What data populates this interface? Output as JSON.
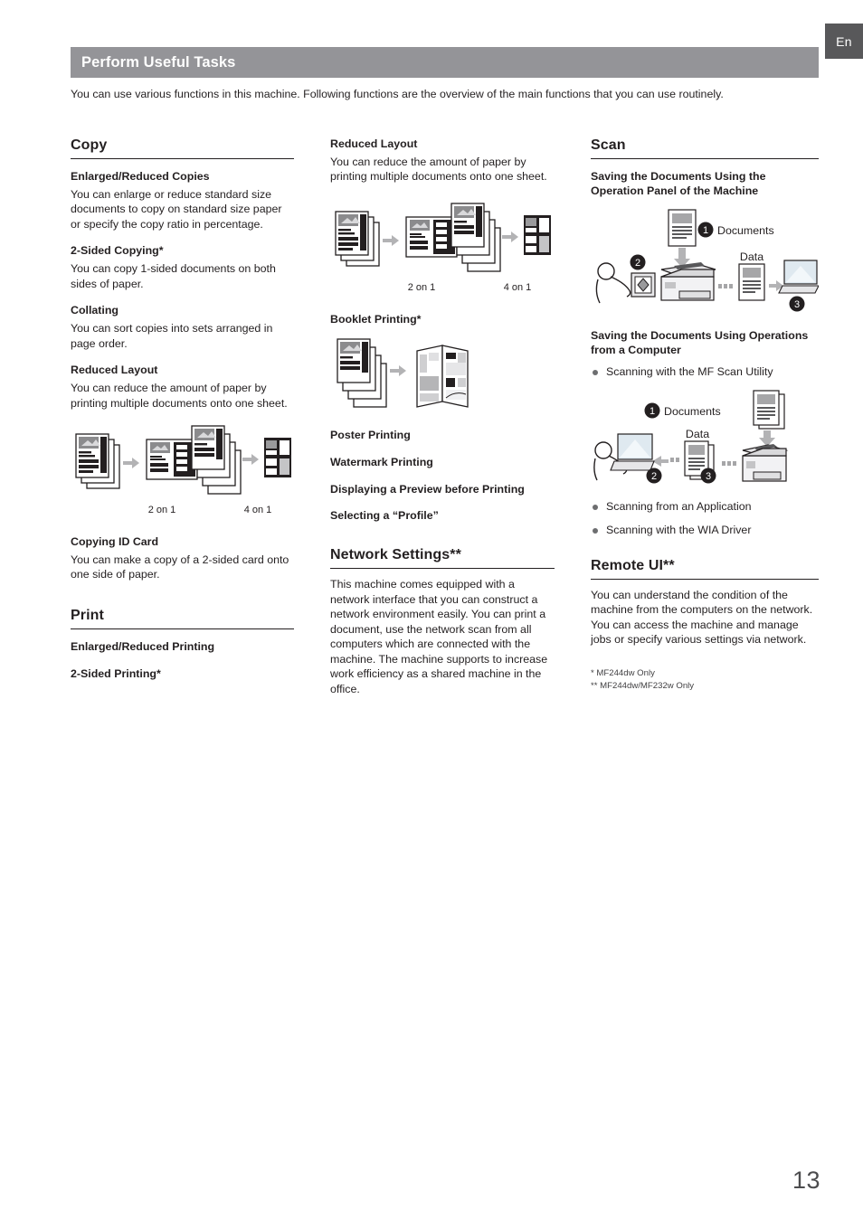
{
  "lang_tab": {
    "label": "En"
  },
  "header": {
    "title": "Perform Useful Tasks"
  },
  "intro": "You can use various functions in this machine. Following functions are the overview of the main functions that you can use routinely.",
  "columns": {
    "left": {
      "copy": {
        "title": "Copy",
        "items": [
          {
            "heading": "Enlarged/Reduced Copies",
            "body": "You can enlarge or reduce standard size documents to copy on standard size paper or specify the copy ratio in percentage."
          },
          {
            "heading": "2-Sided Copying*",
            "body": "You can copy 1-sided documents on both sides of paper."
          },
          {
            "heading": "Collating",
            "body": "You can sort copies into sets arranged in page order."
          },
          {
            "heading": "Reduced Layout",
            "body": "You can reduce the amount of paper by printing multiple documents onto one sheet."
          },
          {
            "heading": "Copying ID Card",
            "body": "You can make a copy of a 2-sided card onto one side of paper."
          }
        ],
        "figure_captions": {
          "left": "2 on 1",
          "right": "4 on 1"
        }
      },
      "print": {
        "title": "Print",
        "items": [
          {
            "heading": "Enlarged/Reduced Printing"
          },
          {
            "heading": "2-Sided Printing*"
          }
        ]
      }
    },
    "middle": {
      "reduced_layout": {
        "heading": "Reduced Layout",
        "body": "You can reduce the amount of paper by printing multiple documents onto one sheet.",
        "figure_captions": {
          "left": "2 on 1",
          "right": "4 on 1"
        }
      },
      "booklet": {
        "heading": "Booklet Printing*"
      },
      "extra_items": [
        {
          "heading": "Poster Printing"
        },
        {
          "heading": "Watermark Printing"
        },
        {
          "heading": "Displaying a Preview before Printing"
        },
        {
          "heading": "Selecting a “Profile”"
        }
      ],
      "network": {
        "title": "Network Settings**",
        "body": "This machine comes equipped with a network interface that you can construct a network environment easily. You can print a document, use the network scan from all computers which are connected with the machine. The machine supports to increase work efficiency as a shared machine in the office."
      }
    },
    "right": {
      "scan": {
        "title": "Scan",
        "panel_heading": "Saving the Documents Using the Operation Panel of the Machine",
        "panel_figure_labels": {
          "documents": "Documents",
          "data": "Data",
          "step1": "1",
          "step2": "2",
          "step3": "3"
        },
        "computer_heading": "Saving the Documents Using Operations from a Computer",
        "bullets_before": [
          "Scanning with the MF Scan Utility"
        ],
        "computer_figure_labels": {
          "documents": "Documents",
          "data": "Data",
          "step1": "1",
          "step2": "2",
          "step3": "3"
        },
        "bullets_after": [
          "Scanning from an Application",
          "Scanning with the WIA Driver"
        ]
      },
      "remote_ui": {
        "title": "Remote UI**",
        "body": "You can understand the condition of the machine from the computers on the network. You can access the machine and manage jobs or specify various settings via network."
      },
      "footnotes": [
        "* MF244dw Only",
        "** MF244dw/MF232w Only"
      ]
    }
  },
  "page_number": "13",
  "colors": {
    "header_bar": "#949498",
    "lang_tab": "#58585a",
    "text": "#231f20",
    "bullet": "#6d6e70"
  }
}
